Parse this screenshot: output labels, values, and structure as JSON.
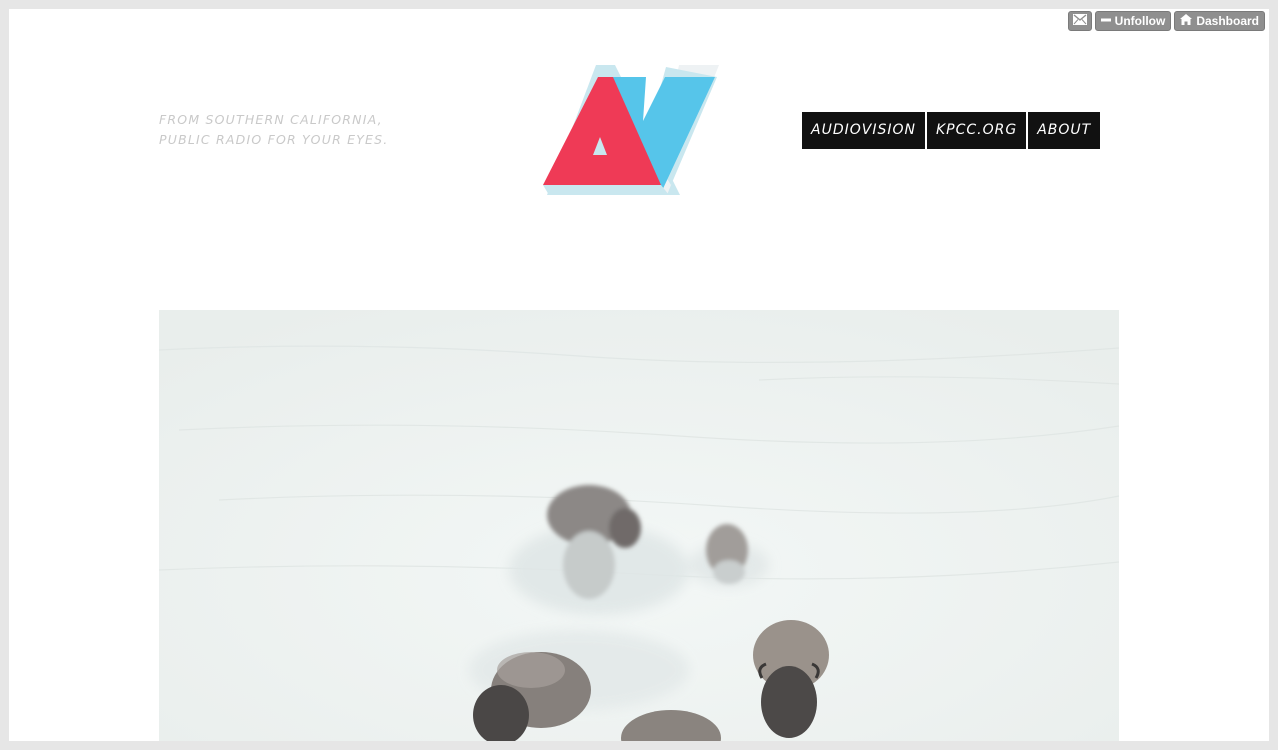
{
  "tumblr_controls": {
    "mail_icon": "envelope-icon",
    "unfollow_icon": "minus-icon",
    "unfollow_label": "Unfollow",
    "dashboard_icon": "home-icon",
    "dashboard_label": "Dashboard"
  },
  "header": {
    "tagline_line1": "FROM SOUTHERN CALIFORNIA,",
    "tagline_line2": "PUBLIC RADIO FOR YOUR EYES."
  },
  "logo": {
    "name": "AV",
    "colors": {
      "red": "#ef3a56",
      "blue": "#56c5ea",
      "pale": "#c9e7ef",
      "shadow": "#eef2f4"
    }
  },
  "nav": {
    "items": [
      {
        "label": "AUDIOVISION"
      },
      {
        "label": "KPCC.ORG"
      },
      {
        "label": "ABOUT"
      }
    ]
  },
  "post": {
    "image_subject": "bison running through snow"
  }
}
